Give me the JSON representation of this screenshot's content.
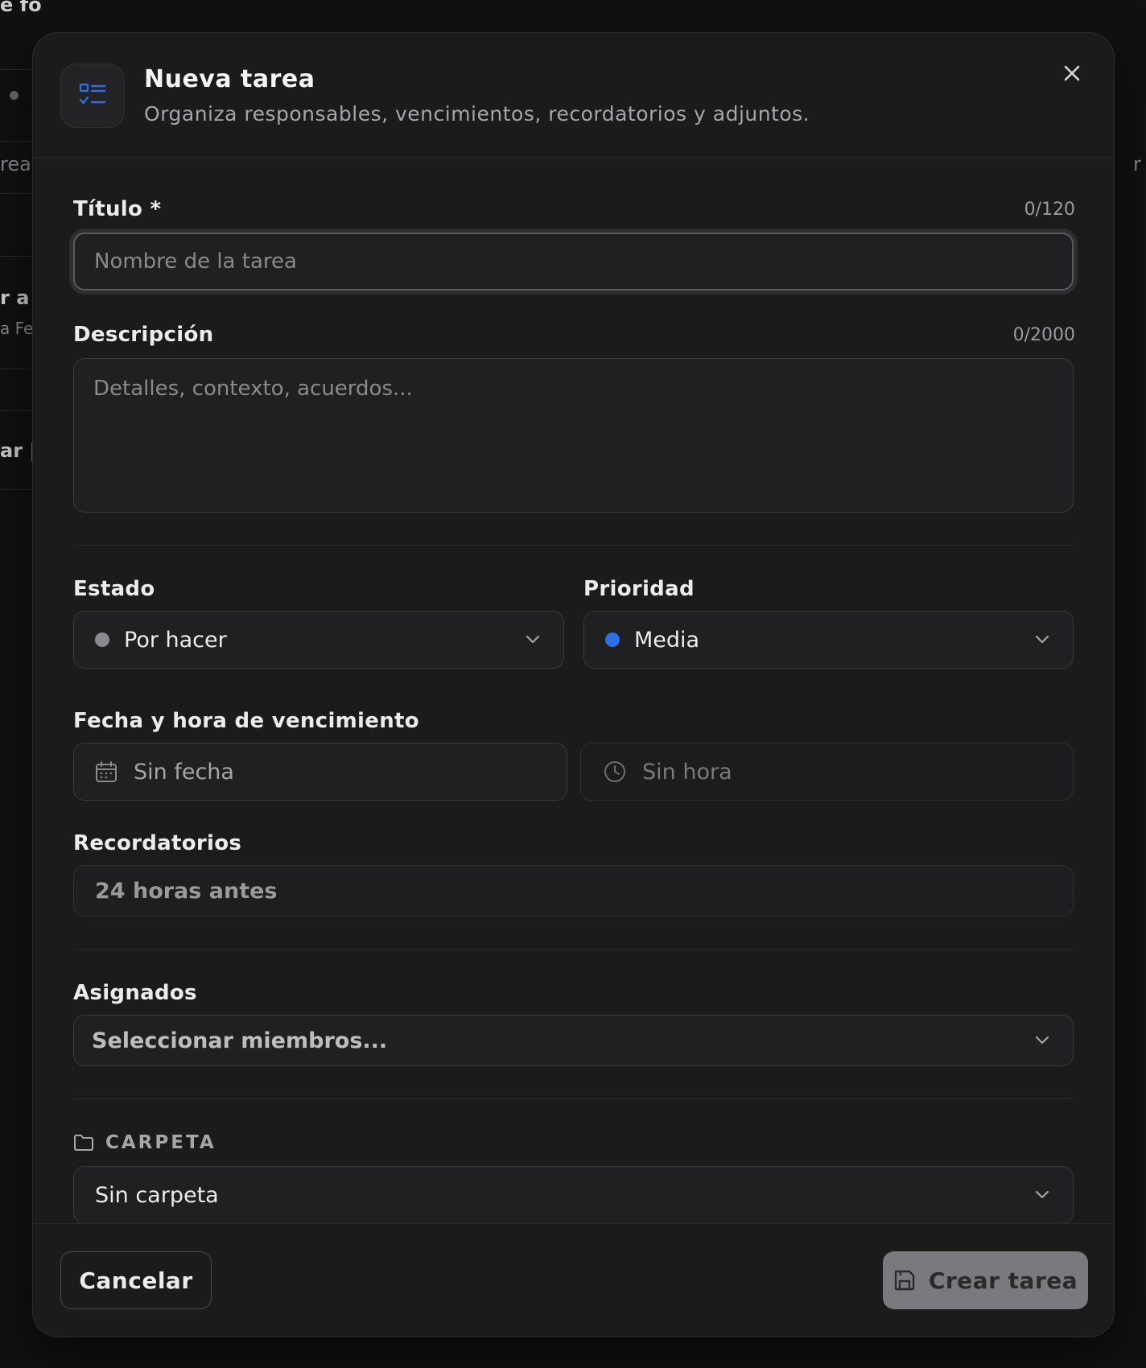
{
  "background": {
    "fragments": [
      "e fo",
      "rea",
      "r a",
      "a Fe",
      "ar |",
      "r"
    ]
  },
  "modal": {
    "title": "Nueva tarea",
    "subtitle": "Organiza responsables, vencimientos, recordatorios y adjuntos.",
    "icon": "task-list-icon",
    "accent_color": "#2f6fe4"
  },
  "form": {
    "title_label": "Título *",
    "title_counter": "0/120",
    "title_placeholder": "Nombre de la tarea",
    "title_value": "",
    "description_label": "Descripción",
    "description_counter": "0/2000",
    "description_placeholder": "Detalles, contexto, acuerdos...",
    "description_value": "",
    "status_label": "Estado",
    "status_value": "Por hacer",
    "status_dot_color": "#8a8a8e",
    "priority_label": "Prioridad",
    "priority_value": "Media",
    "priority_dot_color": "#2f6fe4",
    "due_label": "Fecha y hora de vencimiento",
    "date_placeholder": "Sin fecha",
    "time_placeholder": "Sin hora",
    "reminders_label": "Recordatorios",
    "reminders_value": "24 horas antes",
    "assignees_label": "Asignados",
    "assignees_placeholder": "Seleccionar miembros...",
    "folder_label": "CARPETA",
    "folder_value": "Sin carpeta"
  },
  "footer": {
    "cancel_label": "Cancelar",
    "submit_label": "Crear tarea"
  }
}
